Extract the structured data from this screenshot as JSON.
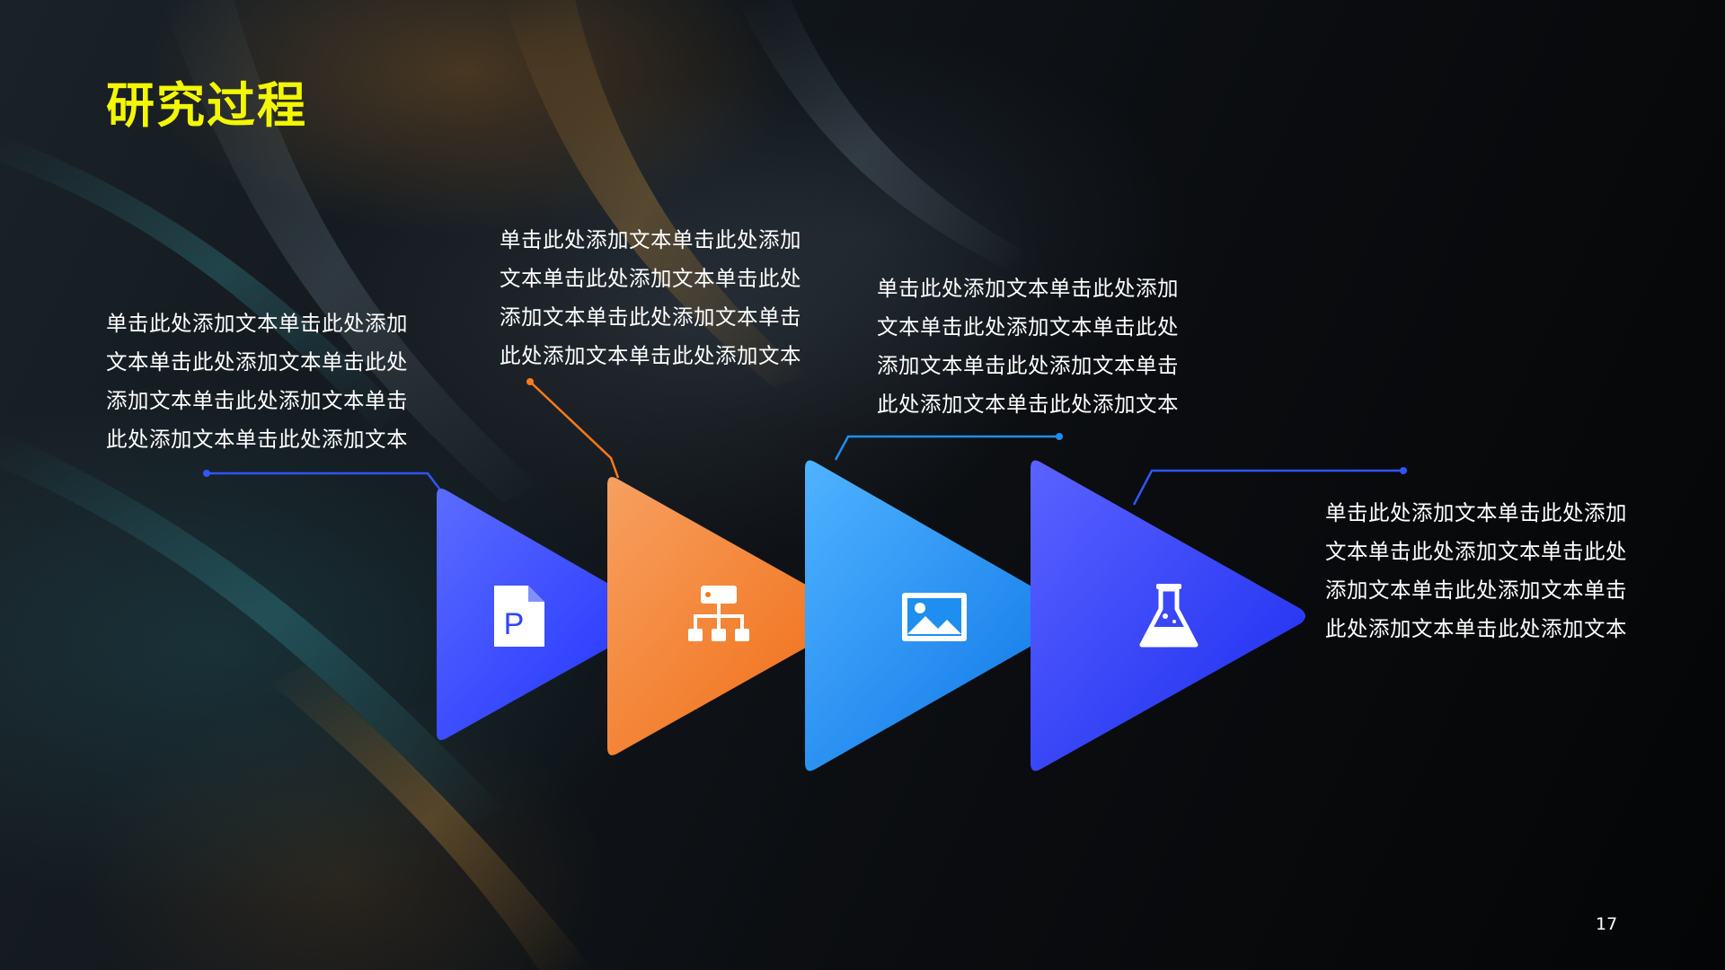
{
  "slide": {
    "title": "研究过程",
    "page_number": "17"
  },
  "steps": [
    {
      "text": "单击此处添加文本单击此处添加文本单击此处添加文本单击此处添加文本单击此处添加文本单击此处添加文本单击此处添加文本",
      "color": "#2f45ff",
      "icon": "powerpoint-file-icon"
    },
    {
      "text": "单击此处添加文本单击此处添加文本单击此处添加文本单击此处添加文本单击此处添加文本单击此处添加文本单击此处添加文本",
      "color": "#f47a1f",
      "icon": "hierarchy-icon"
    },
    {
      "text": "单击此处添加文本单击此处添加文本单击此处添加文本单击此处添加文本单击此处添加文本单击此处添加文本单击此处添加文本",
      "color": "#1e8ff0",
      "icon": "image-icon"
    },
    {
      "text": "单击此处添加文本单击此处添加文本单击此处添加文本单击此处添加文本单击此处添加文本单击此处添加文本单击此处添加文本",
      "color": "#2736f5",
      "icon": "flask-icon"
    }
  ],
  "theme": {
    "title_color": "#f3f700",
    "text_color": "#ffffff",
    "connector_orange": "#ff7a1a",
    "connector_blue": "#2f55ff"
  }
}
